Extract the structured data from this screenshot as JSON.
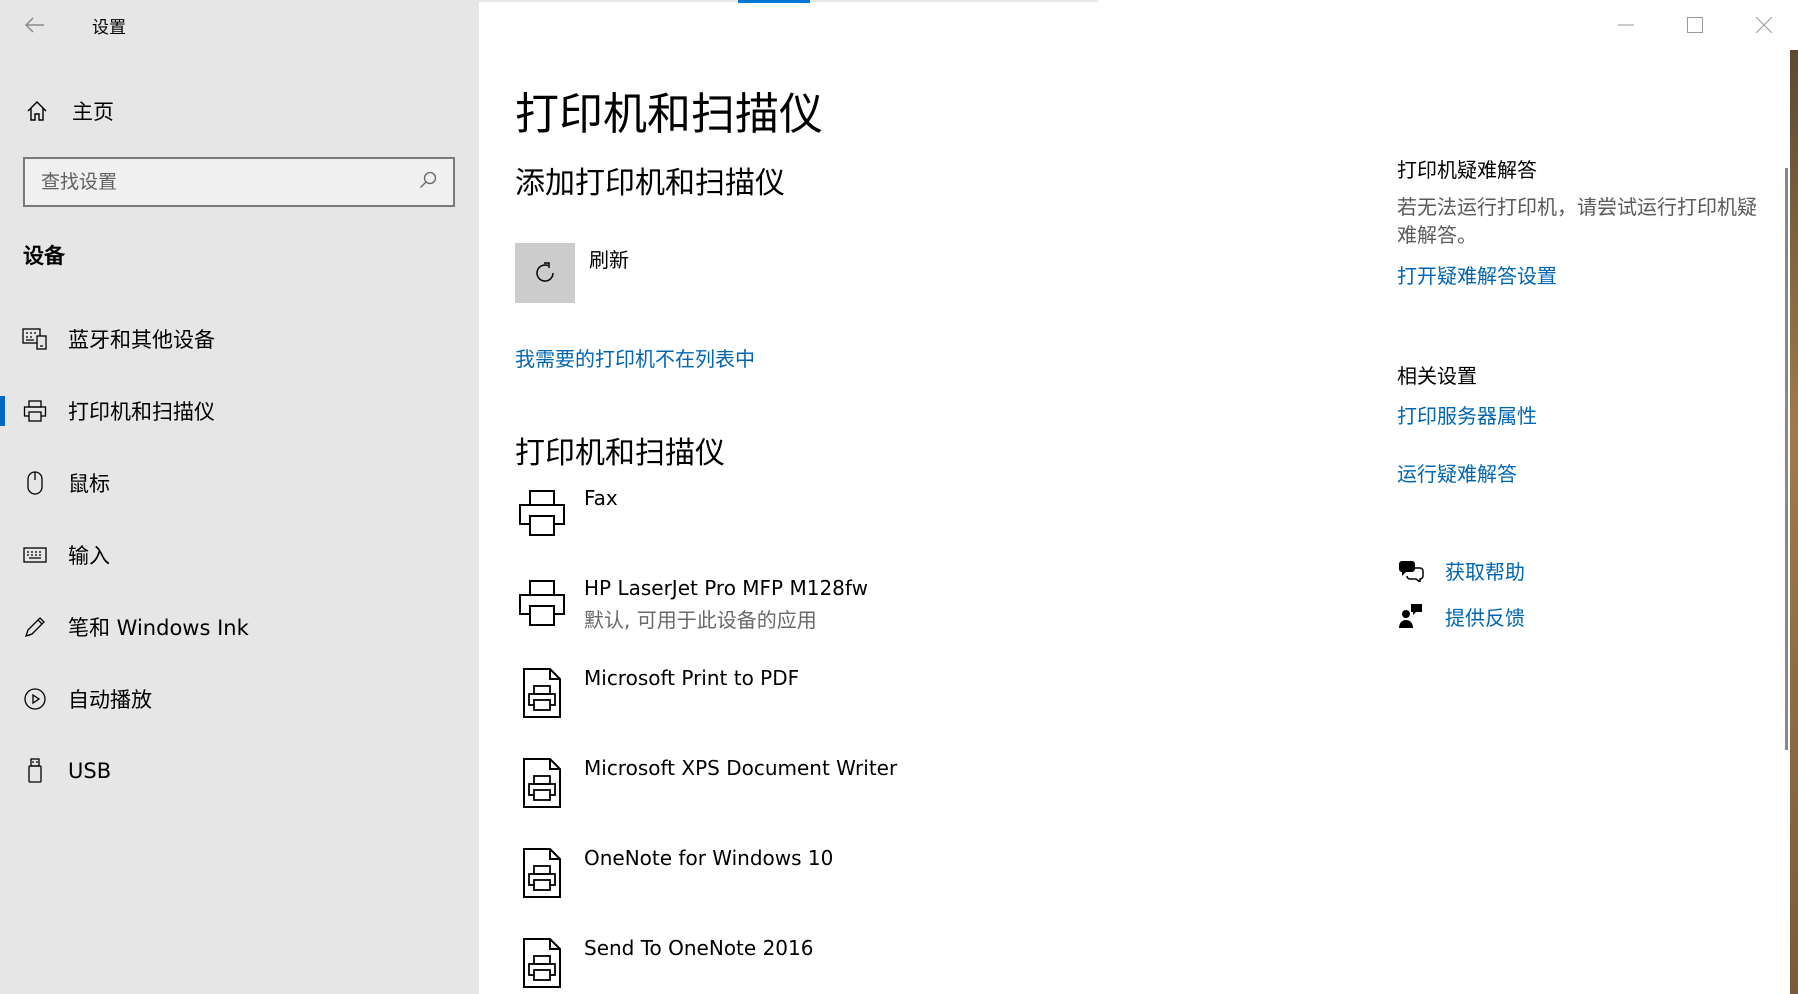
{
  "window": {
    "app_title": "设置"
  },
  "sidebar": {
    "home_label": "主页",
    "search_placeholder": "查找设置",
    "section_heading": "设备",
    "items": [
      {
        "label": "蓝牙和其他设备",
        "icon": "keyboard-device-icon"
      },
      {
        "label": "打印机和扫描仪",
        "icon": "printer-icon",
        "selected": true
      },
      {
        "label": "鼠标",
        "icon": "mouse-icon"
      },
      {
        "label": "输入",
        "icon": "keyboard-icon"
      },
      {
        "label": "笔和 Windows Ink",
        "icon": "pen-icon"
      },
      {
        "label": "自动播放",
        "icon": "autoplay-icon"
      },
      {
        "label": "USB",
        "icon": "usb-icon"
      }
    ]
  },
  "main": {
    "page_title": "打印机和扫描仪",
    "add_heading": "添加打印机和扫描仪",
    "refresh_label": "刷新",
    "not_listed_link": "我需要的打印机不在列表中",
    "list_heading": "打印机和扫描仪",
    "printers": [
      {
        "name": "Fax",
        "status": "",
        "icon": "printer-icon"
      },
      {
        "name": "HP LaserJet Pro MFP M128fw",
        "status": "默认, 可用于此设备的应用",
        "icon": "printer-icon"
      },
      {
        "name": "Microsoft Print to PDF",
        "status": "",
        "icon": "document-printer-icon"
      },
      {
        "name": "Microsoft XPS Document Writer",
        "status": "",
        "icon": "document-printer-icon"
      },
      {
        "name": "OneNote for Windows 10",
        "status": "",
        "icon": "document-printer-icon"
      },
      {
        "name": "Send To OneNote 2016",
        "status": "",
        "icon": "document-printer-icon"
      }
    ]
  },
  "right_panel": {
    "troubleshoot_heading": "打印机疑难解答",
    "troubleshoot_text": "若无法运行打印机，请尝试运行打印机疑难解答。",
    "troubleshoot_link": "打开疑难解答设置",
    "related_heading": "相关设置",
    "print_server_link": "打印服务器属性",
    "run_troubleshooter_link": "运行疑难解答",
    "get_help": "获取帮助",
    "give_feedback": "提供反馈"
  },
  "colors": {
    "accent": "#0078d7",
    "link": "#0066b4",
    "sidebar_bg": "#e6e6e6"
  }
}
